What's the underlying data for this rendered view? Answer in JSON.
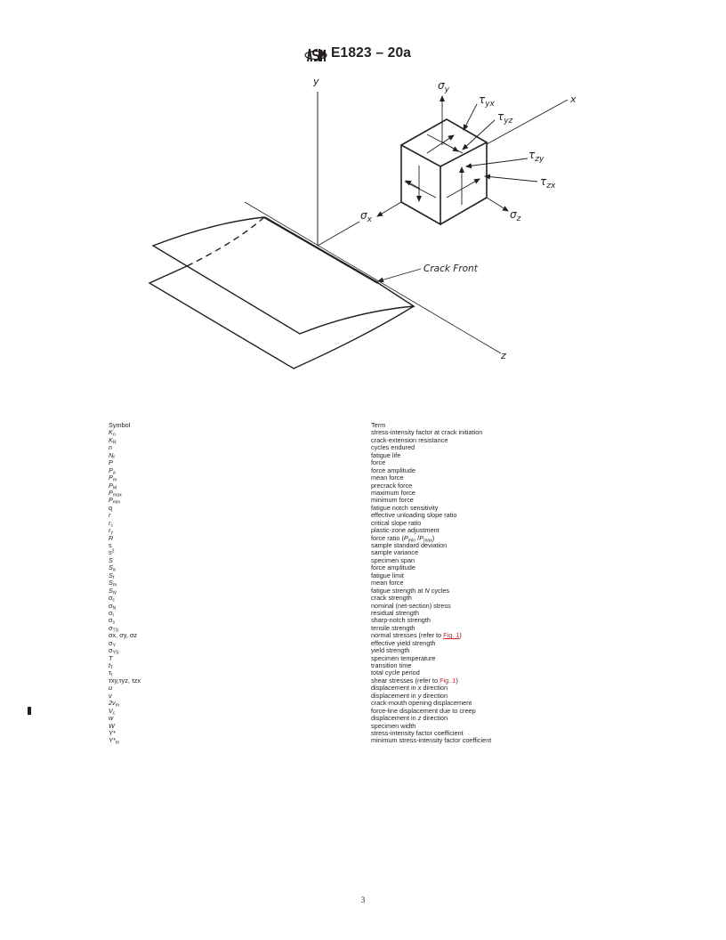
{
  "header": {
    "logo": "astm-logo-icon",
    "doc_id": "E1823 – 20a"
  },
  "figure": {
    "labels": {
      "y_axis": "y",
      "x_axis": "x",
      "z_axis": "z",
      "sigma_y": "σ",
      "sigma_y_sub": "y",
      "sigma_x": "σ",
      "sigma_x_sub": "x",
      "sigma_z": "σ",
      "sigma_z_sub": "z",
      "tau_yx": "τ",
      "tau_yx_sub": "yx",
      "tau_yz": "τ",
      "tau_yz_sub": "yz",
      "tau_zy": "τ",
      "tau_zy_sub": "zy",
      "tau_zx": "τ",
      "tau_zx_sub": "zx",
      "crack_front": "Crack Front"
    }
  },
  "table": {
    "header": {
      "symbol": "Symbol",
      "term": "Term"
    },
    "rows": [
      {
        "symbol": "K",
        "sym_sub": "o",
        "term": "stress-intensity factor at crack initiation"
      },
      {
        "symbol": "K",
        "sym_sub": "R",
        "term": "crack-extension resistance"
      },
      {
        "symbol": "n",
        "sym_sub": "",
        "term": "cycles endured"
      },
      {
        "symbol": "N",
        "sym_sub": "f",
        "term": "fatigue life"
      },
      {
        "symbol": "P",
        "sym_sub": "",
        "term": "force"
      },
      {
        "symbol": "P",
        "sym_sub": "a",
        "term": "force amplitude"
      },
      {
        "symbol": "P",
        "sym_sub": "m",
        "term": "mean force"
      },
      {
        "symbol": "P",
        "sym_sub": "M",
        "term": "precrack force"
      },
      {
        "symbol": "P",
        "sym_sub": "max",
        "term": "maximum force"
      },
      {
        "symbol": "P",
        "sym_sub": "min",
        "term": "minimum force"
      },
      {
        "symbol": "q",
        "sym_sub": "",
        "term": "fatigue notch sensitivity"
      },
      {
        "symbol": "r",
        "sym_sub": "",
        "term": "effective unloading slope ratio"
      },
      {
        "symbol": "r",
        "sym_sub": "c",
        "term": "critical slope ratio"
      },
      {
        "symbol": "r",
        "sym_sub": "y",
        "term": "plastic-zone adjustment"
      },
      {
        "symbol": "R",
        "sym_sub": "",
        "term": "force ratio (",
        "term_p1": "P",
        "term_p1_sub": "min",
        "term_slash": " /",
        "term_p2": "P",
        "term_p2_sub": "max",
        "term_end": ")"
      },
      {
        "symbol": "s",
        "sym_sub": "",
        "term": "sample standard deviation"
      },
      {
        "symbol": "s",
        "sym_sup": "2",
        "term": "sample variance"
      },
      {
        "symbol": "S",
        "sym_sub": "",
        "term": "specimen span"
      },
      {
        "symbol": "S",
        "sym_sub": "a",
        "term": "force amplitude"
      },
      {
        "symbol": "S",
        "sym_sub": "f",
        "term": "fatigue limit"
      },
      {
        "symbol": "S",
        "sym_sub": "m",
        "term": "mean force"
      },
      {
        "symbol": "S",
        "sym_sub": "N",
        "term": "fatigue strength at ",
        "term_it": "N",
        "term_end": " cycles"
      },
      {
        "symbol": "σ",
        "sym_sub": "c",
        "term": "crack strength"
      },
      {
        "symbol": "σ",
        "sym_sub": "N",
        "term": "nominal (net-section) stress"
      },
      {
        "symbol": "σ",
        "sym_sub": "r",
        "term": "residual strength"
      },
      {
        "symbol": "σ",
        "sym_sub": "s",
        "term": "sharp-notch strength"
      },
      {
        "symbol": "σ",
        "sym_sub": "TS",
        "term": "tensile strength"
      },
      {
        "symbol": "σx, σy, σz",
        "term": "normal stresses (refer to ",
        "term_link": "Fig. 1",
        "term_end": ")"
      },
      {
        "symbol": "σ",
        "sym_sub": "Y",
        "term": "effective yield strength"
      },
      {
        "symbol": "σ",
        "sym_sub": "YS",
        "term": "yield strength"
      },
      {
        "symbol": "T",
        "sym_sub": "",
        "term": "specimen temperature"
      },
      {
        "symbol": "t",
        "sym_sub": "T",
        "term": "transition time"
      },
      {
        "symbol": "τ",
        "sym_sub": "t",
        "term": "total cycle period"
      },
      {
        "symbol": "τxy,τyz, τzx",
        "term": "shear stresses (refer to ",
        "term_link": "Fig. 1",
        "term_end": ")"
      },
      {
        "symbol": "u",
        "sym_sub": "",
        "term": "displacement in ",
        "term_it": "x",
        "term_end": " direction"
      },
      {
        "symbol": "v",
        "sym_sub": "",
        "term": "displacement in ",
        "term_it": "y",
        "term_end": " direction"
      },
      {
        "symbol": "2v",
        "sym_sub": "m",
        "term": "crack-mouth opening displacement"
      },
      {
        "symbol": "V",
        "sym_sub": "c",
        "term": "force-line displacement due to creep"
      },
      {
        "symbol": "w",
        "sym_sub": "",
        "term": "displacement in ",
        "term_it": "z",
        "term_end": " direction"
      },
      {
        "symbol": "W",
        "sym_sub": "",
        "term": "specimen width"
      },
      {
        "symbol": "Y*",
        "sym_sub": "",
        "term": "stress-intensity factor coefficient"
      },
      {
        "symbol": "Y*",
        "sym_sub": "m",
        "term": "minimum stress-intensity factor coefficient"
      }
    ]
  },
  "footer": {
    "page_number": "3"
  }
}
